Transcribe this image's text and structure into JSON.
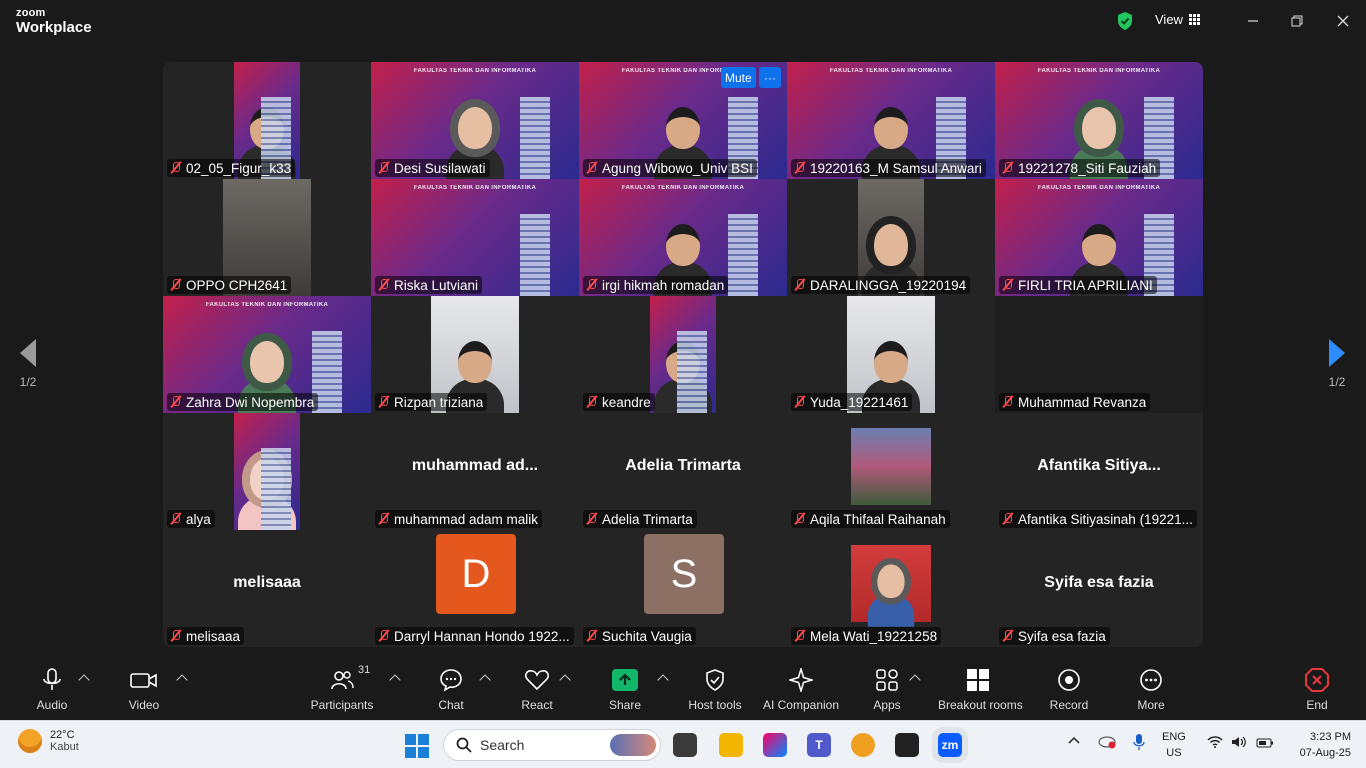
{
  "app": {
    "brand_small": "zoom",
    "brand_large": "Workplace"
  },
  "titlebar": {
    "view_label": "View",
    "security_icon": "shield-check-icon"
  },
  "participants": [
    {
      "name": "02_05_Figur_k33",
      "bg": "fti",
      "face": "hair",
      "video_w": 66
    },
    {
      "name": "Desi Susilawati",
      "bg": "fti",
      "face": "hijab",
      "speaking": true,
      "video_w": 208
    },
    {
      "name": "Agung Wibowo_Univ BSI",
      "bg": "fti",
      "face": "hair",
      "video_w": 208,
      "hover": true
    },
    {
      "name": "19220163_M Samsul Anwari",
      "bg": "fti",
      "face": "hair",
      "video_w": 208
    },
    {
      "name": "19221278_Siti Fauziah",
      "bg": "fti",
      "face": "hijab-green",
      "video_w": 208
    },
    {
      "name": "OPPO CPH2641",
      "bg": "photo",
      "face": "none",
      "video_w": 88
    },
    {
      "name": "Riska Lutviani",
      "bg": "fti",
      "face": "none",
      "video_w": 208
    },
    {
      "name": "irgi hikmah romadan",
      "bg": "fti",
      "face": "hair",
      "video_w": 208
    },
    {
      "name": "DARALINGGA_19220194",
      "bg": "photo",
      "face": "hijab-dark",
      "video_w": 66
    },
    {
      "name": "FIRLI TRIA APRILIANI",
      "bg": "fti",
      "face": "hair",
      "video_w": 208
    },
    {
      "name": "Zahra Dwi Nopembra",
      "bg": "fti",
      "face": "hijab-green",
      "video_w": 208
    },
    {
      "name": "Rizpan triziana",
      "bg": "light",
      "face": "hair",
      "video_w": 88
    },
    {
      "name": "keandre",
      "bg": "fti",
      "face": "hair",
      "video_w": 66
    },
    {
      "name": "Yuda_19221461",
      "bg": "light",
      "face": "hair",
      "video_w": 88
    },
    {
      "name": "Muhammad Revanza",
      "bg": "dark",
      "face": "none",
      "video_w": 208
    },
    {
      "name": "alya",
      "bg": "fti",
      "face": "hijab-pink",
      "video_w": 66
    },
    {
      "name": "muhammad adam malik",
      "center": "muhammad  ad...",
      "bg": "none",
      "face": "none",
      "video_w": 0
    },
    {
      "name": "Adelia Trimarta",
      "center": "Adelia Trimarta",
      "bg": "none",
      "face": "none",
      "video_w": 0
    },
    {
      "name": "Aqila Thifaal Raihanah",
      "bg": "flowers",
      "face": "none",
      "video_w": 80,
      "small_photo": true
    },
    {
      "name": "Afantika Sitiyasinah (19221...",
      "center": "Afantika Sitiya...",
      "bg": "none",
      "face": "none",
      "video_w": 0
    },
    {
      "name": "melisaaa",
      "center": "melisaaa",
      "bg": "none",
      "face": "none",
      "video_w": 0
    },
    {
      "name": "Darryl Hannan Hondo 1922...",
      "letter": "D",
      "letter_color": "#e5581d",
      "bg": "none",
      "face": "none",
      "video_w": 0
    },
    {
      "name": "Suchita Vaugia",
      "letter": "S",
      "letter_color": "#8c7064",
      "bg": "none",
      "face": "none",
      "video_w": 0
    },
    {
      "name": "Mela Wati_19221258",
      "bg": "red",
      "face": "hijab-blue",
      "video_w": 80,
      "small_photo": true
    },
    {
      "name": "Syifa esa fazia",
      "center": "Syifa esa fazia",
      "bg": "none",
      "face": "none",
      "video_w": 0
    }
  ],
  "fti_banner": "FAKULTAS TEKNIK DAN INFORMATIKA",
  "tile_actions": {
    "mute": "Mute",
    "more": "···"
  },
  "pager": {
    "left": "1/2",
    "right": "1/2"
  },
  "toolbar": {
    "audio": "Audio",
    "video": "Video",
    "participants": "Participants",
    "participants_count": "31",
    "chat": "Chat",
    "react": "React",
    "share": "Share",
    "host_tools": "Host tools",
    "ai_companion": "AI Companion",
    "apps": "Apps",
    "breakout": "Breakout rooms",
    "record": "Record",
    "more": "More",
    "end": "End"
  },
  "taskbar": {
    "temp": "22°C",
    "weather": "Kabut",
    "search_placeholder": "Search",
    "lang1": "ENG",
    "lang2": "US",
    "time": "3:23 PM",
    "date": "07-Aug-25"
  },
  "colors": {
    "accent": "#0e72ed",
    "speaking": "#2ecc9a",
    "mute": "#ff4a4a",
    "share": "#12b76a",
    "end": "#e5383b"
  }
}
